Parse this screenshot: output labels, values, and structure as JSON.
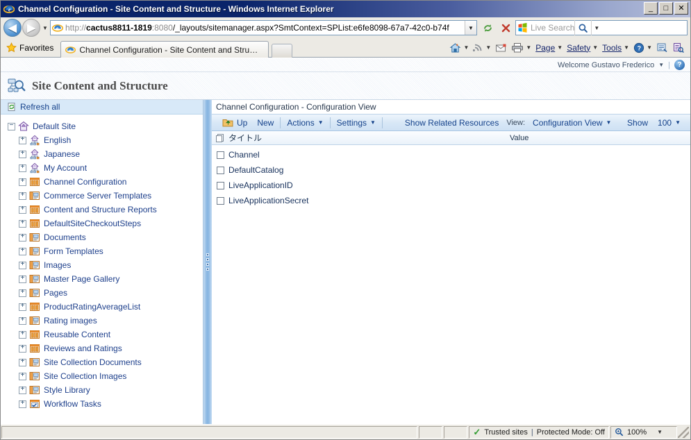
{
  "window": {
    "title": "Channel Configuration - Site Content and Structure - Windows Internet Explorer",
    "minimize_label": "_",
    "maximize_label": "□",
    "close_label": "✕"
  },
  "navigation": {
    "back_label": "◀",
    "forward_label": "▶",
    "history_caret": "▼",
    "address": {
      "scheme": "http://",
      "host": "cactus8811-1819",
      "port": ":8080",
      "path": "/_layouts/sitemanager.aspx?SmtContext=SPList:e6fe8098-67a7-42c0-b74f",
      "full": "http://cactus8811-1819:8080/_layouts/sitemanager.aspx?SmtContext=SPList:e6fe8098-67a7-42c0-b74f",
      "dropdown_caret": "▼"
    },
    "refresh_icon": "refresh-icon",
    "stop_icon": "stop-icon",
    "search": {
      "placeholder": "Live Search",
      "go_icon": "magnifier-icon",
      "provider_caret": "▼"
    }
  },
  "favorites": {
    "label": "Favorites",
    "star_icon": "star-icon"
  },
  "tabs": [
    {
      "title": "Channel Configuration - Site Content and Structure",
      "active": true
    }
  ],
  "newtab": {
    "label": ""
  },
  "command_bar": {
    "items": [
      {
        "name": "home",
        "label": "",
        "icon": "home-icon",
        "caret": "▼"
      },
      {
        "name": "feeds",
        "label": "",
        "icon": "rss-icon",
        "caret": "▼"
      },
      {
        "name": "read-mail",
        "label": "",
        "icon": "mail-icon",
        "caret": ""
      },
      {
        "name": "print",
        "label": "",
        "icon": "printer-icon",
        "caret": "▼"
      },
      {
        "name": "page",
        "label": "Page",
        "icon": "",
        "caret": "▼"
      },
      {
        "name": "safety",
        "label": "Safety",
        "icon": "",
        "caret": "▼"
      },
      {
        "name": "tools",
        "label": "Tools",
        "icon": "",
        "caret": "▼"
      },
      {
        "name": "help",
        "label": "",
        "icon": "help-icon",
        "caret": "▼"
      },
      {
        "name": "research",
        "label": "",
        "icon": "research-icon",
        "caret": ""
      },
      {
        "name": "onenote",
        "label": "",
        "icon": "onenote-icon",
        "caret": ""
      }
    ]
  },
  "welcome": {
    "text": "Welcome Gustavo Frederico",
    "caret": "▼",
    "separator": "|",
    "help_label": "?"
  },
  "page_header": {
    "title": "Site Content and Structure",
    "icon": "site-structure-icon"
  },
  "left_pane": {
    "refresh_all": {
      "label": "Refresh all",
      "icon": "refresh-all-icon"
    },
    "tree": [
      {
        "label": "Default Site",
        "level": 0,
        "icon": "home-site-icon",
        "expander": "−"
      },
      {
        "label": "English",
        "level": 1,
        "icon": "subsite-icon",
        "expander": "+"
      },
      {
        "label": "Japanese",
        "level": 1,
        "icon": "subsite-icon",
        "expander": "+"
      },
      {
        "label": "My Account",
        "level": 1,
        "icon": "subsite-icon",
        "expander": "+"
      },
      {
        "label": "Channel Configuration",
        "level": 1,
        "icon": "list-icon",
        "expander": "+"
      },
      {
        "label": "Commerce Server Templates",
        "level": 1,
        "icon": "doclib-icon",
        "expander": "+"
      },
      {
        "label": "Content and Structure Reports",
        "level": 1,
        "icon": "list-icon",
        "expander": "+"
      },
      {
        "label": "DefaultSiteCheckoutSteps",
        "level": 1,
        "icon": "list-icon",
        "expander": "+"
      },
      {
        "label": "Documents",
        "level": 1,
        "icon": "doclib-icon",
        "expander": "+"
      },
      {
        "label": "Form Templates",
        "level": 1,
        "icon": "doclib-icon",
        "expander": "+"
      },
      {
        "label": "Images",
        "level": 1,
        "icon": "doclib-icon",
        "expander": "+"
      },
      {
        "label": "Master Page Gallery",
        "level": 1,
        "icon": "doclib-icon",
        "expander": "+"
      },
      {
        "label": "Pages",
        "level": 1,
        "icon": "doclib-icon",
        "expander": "+"
      },
      {
        "label": "ProductRatingAverageList",
        "level": 1,
        "icon": "list-icon",
        "expander": "+"
      },
      {
        "label": "Rating images",
        "level": 1,
        "icon": "doclib-icon",
        "expander": "+"
      },
      {
        "label": "Reusable Content",
        "level": 1,
        "icon": "list-icon",
        "expander": "+"
      },
      {
        "label": "Reviews and Ratings",
        "level": 1,
        "icon": "list-icon",
        "expander": "+"
      },
      {
        "label": "Site Collection Documents",
        "level": 1,
        "icon": "doclib-icon",
        "expander": "+"
      },
      {
        "label": "Site Collection Images",
        "level": 1,
        "icon": "doclib-icon",
        "expander": "+"
      },
      {
        "label": "Style Library",
        "level": 1,
        "icon": "doclib-icon",
        "expander": "+"
      },
      {
        "label": "Workflow Tasks",
        "level": 1,
        "icon": "tasks-icon",
        "expander": "+"
      }
    ]
  },
  "right_pane": {
    "title": "Channel Configuration - Configuration View",
    "toolbar": {
      "up_label": "Up",
      "up_icon": "up-folder-icon",
      "new_label": "New",
      "actions_label": "Actions",
      "actions_caret": "▼",
      "settings_label": "Settings",
      "settings_caret": "▼",
      "show_related_label": "Show Related Resources",
      "view_prefix": "View:",
      "view_value": "Configuration View",
      "view_caret": "▼",
      "show_prefix": "Show",
      "show_value": "100",
      "show_caret": "▼"
    },
    "list": {
      "select_all_icon": "select-all-icon",
      "columns": [
        "タイトル",
        "Value"
      ],
      "rows": [
        {
          "title": "Channel",
          "value": ""
        },
        {
          "title": "DefaultCatalog",
          "value": ""
        },
        {
          "title": "LiveApplicationID",
          "value": ""
        },
        {
          "title": "LiveApplicationSecret",
          "value": ""
        }
      ]
    }
  },
  "status_bar": {
    "message": "",
    "zone_label": "Trusted sites",
    "zone_separator": "|",
    "protected_mode": "Protected Mode: Off",
    "zone_icon": "shield-check-icon",
    "zoom_icon": "zoom-icon",
    "zoom_level": "100%",
    "zoom_caret": "▼"
  },
  "colors": {
    "titlebar_start": "#0a246a",
    "link_blue": "#1d3f8b",
    "toolbar_blue": "#15428b",
    "pane_divider": "#8ab7e2",
    "chrome_gray": "#eceae4"
  }
}
